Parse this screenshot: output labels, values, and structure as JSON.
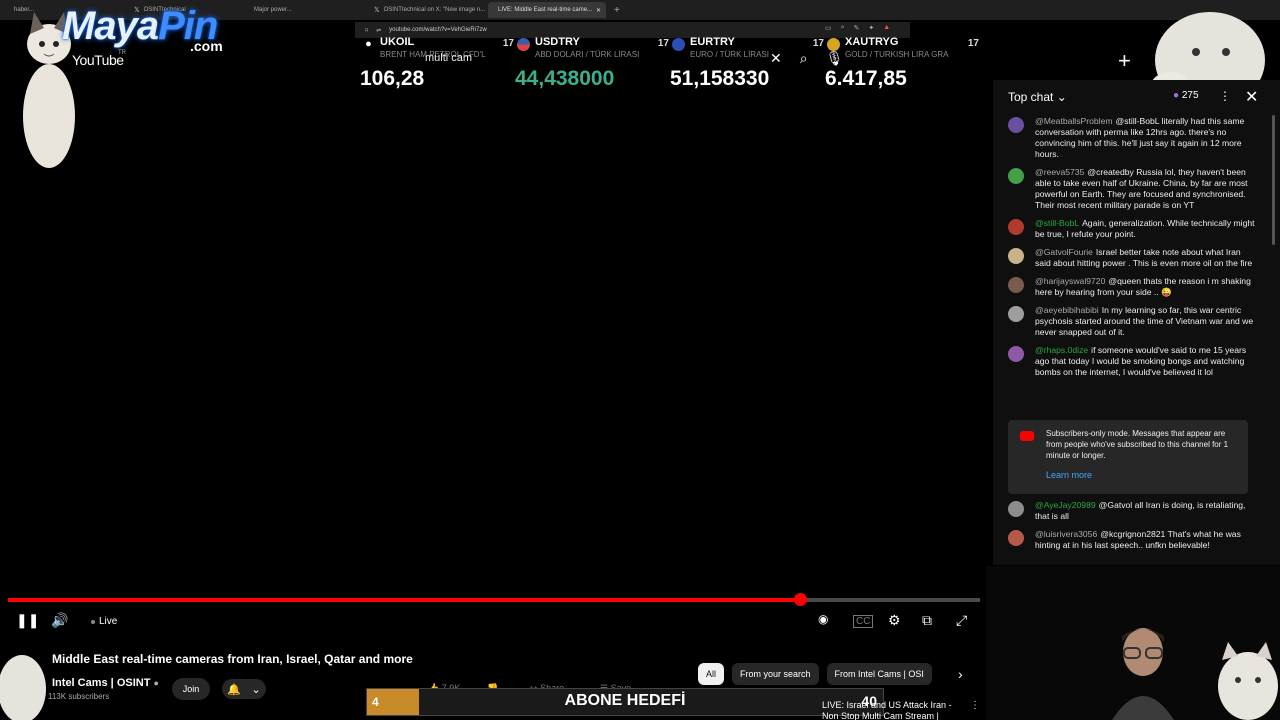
{
  "browser": {
    "tabs": [
      {
        "label": "haber..."
      },
      {
        "label": "OSINTtechnical"
      },
      {
        "label": "Major power..."
      },
      {
        "label": "OSINTtechnical on X: \"New image n..."
      },
      {
        "label": "LIVE: Middle East real-time came..."
      }
    ],
    "new_tab": "+",
    "url": "youtube.com/watch?v=VehGieRi7zw"
  },
  "ticker": [
    {
      "symbol": "UKOIL",
      "name": "BRENT HAM PETROL CFD'L",
      "value": "106,28",
      "color": "#ffffff"
    },
    {
      "symbol": "USDTRY",
      "name": "ABD DOLARI / TÜRK LİRASI",
      "value": "44,438000",
      "color": "#3bb08f"
    },
    {
      "symbol": "EURTRY",
      "name": "EURO / TÜRK LİRASI",
      "value": "51,158330",
      "color": "#ffffff"
    },
    {
      "symbol": "XAUTRYG",
      "name": "GOLD / TURKISH LIRA GRA",
      "value": "6.417,85",
      "color": "#ffffff"
    }
  ],
  "overlay": {
    "logo_maya": "Maya",
    "logo_pin": "Pin",
    "logo_com": ".com",
    "logo_tr": "TR",
    "youtube_word": "YouTube",
    "search_text": "multi cam"
  },
  "player": {
    "progress": 0.815,
    "live_label": "Live"
  },
  "chat": {
    "header": "Top chat",
    "viewer_count": "275",
    "messages": [
      {
        "author": "@MeatballsProblem",
        "text": "@still-BobL literally had this same conversation with perma like 12hrs ago. there's no convincing him of this. he'll just say it again in 12 more hours.",
        "avatar_color": "#6b4f9e",
        "style": ""
      },
      {
        "author": "@reeva5735",
        "text": "@createdby Russia lol, they haven't been able to take even half of Ukraine. China, by far are most powerful on Earth. They are focused and synchronised. Their most recent military parade is on YT",
        "avatar_color": "#43a047",
        "style": ""
      },
      {
        "author": "@still-BobL",
        "text": "Again, generalization. While technically might be true, I refute your point.",
        "avatar_color": "#b03a2e",
        "style": "green"
      },
      {
        "author": "@GatvolFourie",
        "text": "Israel better take note about what Iran said about hitting power . This is even more oil on the fire",
        "avatar_color": "#c9b28a",
        "style": ""
      },
      {
        "author": "@harijayswal9720",
        "text": "@queen thats the reason i m shaking here by hearing from your side .. 😜",
        "avatar_color": "#7a5c4f",
        "style": ""
      },
      {
        "author": "@aeyebibihabibi",
        "text": "In my learning so far, this war centric psychosis started around the time of Vietnam war and we never snapped out of it.",
        "avatar_color": "#9e9e9e",
        "style": ""
      },
      {
        "author": "@rhaps.0dize",
        "text": "if someone would've said to me 15 years ago that today I would be smoking bongs and watching bombs on the internet, I would've believed it lol",
        "avatar_color": "#8e5aa8",
        "style": "green"
      }
    ],
    "subscribers_notice": "Subscribers-only mode. Messages that appear are from people who've subscribed to this channel for 1 minute or longer.",
    "learn_more": "Learn more",
    "messages_after": [
      {
        "author": "@AyeJay20989",
        "text": "@Gatvol all Iran is doing, is retaliating, that is all",
        "avatar_color": "#8d8d8d",
        "style": "green"
      },
      {
        "author": "@luisrivera3056",
        "text": "@kcgrignon2821 That's what he was hinting at in his last speech.. unfkn believable!",
        "avatar_color": "#b55a4a",
        "style": ""
      }
    ]
  },
  "video": {
    "title": "Middle East real-time cameras from Iran, Israel, Qatar and more",
    "channel": "Intel Cams | OSINT",
    "subscribers": "113K subscribers",
    "join_label": "Join",
    "likes": "7.9K",
    "share_label": "Share",
    "save_label": "Save"
  },
  "chips": [
    {
      "label": "All",
      "active": true
    },
    {
      "label": "From your search",
      "active": false
    },
    {
      "label": "From Intel Cams | OSI",
      "active": false
    }
  ],
  "goal": {
    "label": "ABONE HEDEFİ",
    "current": "4",
    "target": "40",
    "fraction": 0.1
  },
  "related": {
    "title_line1": "LIVE: Israel and US Attack Iran -",
    "title_line2": "Non Stop Multi Cam Stream |"
  }
}
